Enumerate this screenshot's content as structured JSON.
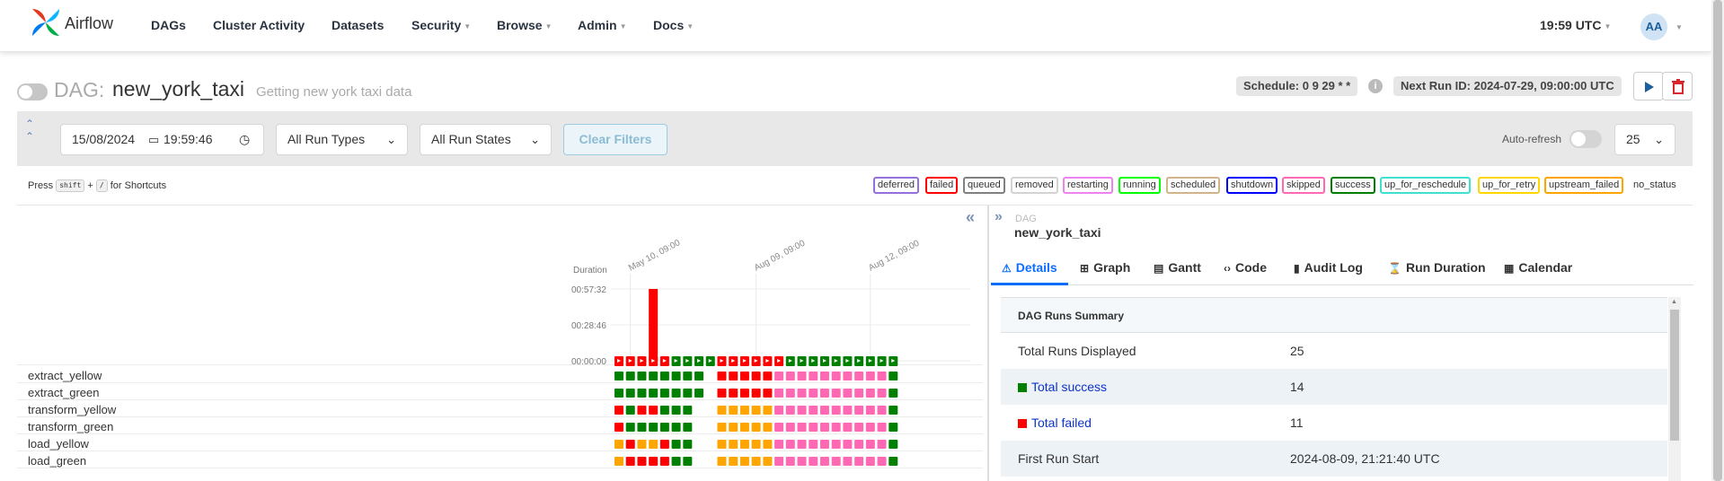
{
  "navbar": {
    "brand": "Airflow",
    "items": [
      {
        "label": "DAGs",
        "dropdown": false
      },
      {
        "label": "Cluster Activity",
        "dropdown": false
      },
      {
        "label": "Datasets",
        "dropdown": false
      },
      {
        "label": "Security",
        "dropdown": true
      },
      {
        "label": "Browse",
        "dropdown": true
      },
      {
        "label": "Admin",
        "dropdown": true
      },
      {
        "label": "Docs",
        "dropdown": true
      }
    ],
    "time": "19:59 UTC",
    "avatar_initials": "AA"
  },
  "dag_header": {
    "prefix": "DAG:",
    "name": "new_york_taxi",
    "description": "Getting new york taxi data",
    "schedule": "Schedule: 0 9 29 * *",
    "next_run": "Next Run ID: 2024-07-29, 09:00:00 UTC"
  },
  "filters": {
    "date": "15/08/2024",
    "time": "19:59:46",
    "run_types": "All Run Types",
    "run_states": "All Run States",
    "clear_label": "Clear Filters",
    "auto_refresh_label": "Auto-refresh",
    "page_size": "25"
  },
  "shortcuts": {
    "press": "Press",
    "key1": "shift",
    "plus": "+",
    "key2": "/",
    "suffix": "for Shortcuts"
  },
  "legend": {
    "items": [
      {
        "label": "deferred",
        "color": "#9370db"
      },
      {
        "label": "failed",
        "color": "#ff0000"
      },
      {
        "label": "queued",
        "color": "#808080"
      },
      {
        "label": "removed",
        "color": "#d3d3d3"
      },
      {
        "label": "restarting",
        "color": "#ee82ee"
      },
      {
        "label": "running",
        "color": "#00ff00"
      },
      {
        "label": "scheduled",
        "color": "#d2b48c"
      },
      {
        "label": "shutdown",
        "color": "#0000ff"
      },
      {
        "label": "skipped",
        "color": "#ff69b4"
      },
      {
        "label": "success",
        "color": "#008000"
      },
      {
        "label": "up_for_reschedule",
        "color": "#40e0d0"
      },
      {
        "label": "up_for_retry",
        "color": "#ffd700"
      },
      {
        "label": "upstream_failed",
        "color": "#ffa500"
      }
    ],
    "no_status": "no_status"
  },
  "grid": {
    "duration_label": "Duration",
    "duration_ticks": [
      "00:57:32",
      "00:28:46",
      "00:00:00"
    ],
    "date_labels": [
      "May 10, 09:00",
      "Aug 09, 09:00",
      "Aug 12, 09:00"
    ],
    "run_states": [
      "failed",
      "failed",
      "failed",
      "failed",
      "failed",
      "success",
      "success",
      "success",
      "success",
      "failed",
      "failed",
      "failed",
      "failed",
      "failed",
      "failed",
      "success",
      "success",
      "success",
      "success",
      "success",
      "success",
      "success",
      "success",
      "success",
      "success"
    ],
    "run_durations_sec": [
      0,
      0,
      0,
      3452,
      0,
      0,
      0,
      0,
      0,
      0,
      0,
      0,
      0,
      0,
      0,
      0,
      0,
      0,
      0,
      0,
      0,
      0,
      0,
      0,
      0
    ],
    "tasks": [
      "extract_yellow",
      "extract_green",
      "transform_yellow",
      "transform_green",
      "load_yellow",
      "load_green"
    ],
    "task_states": [
      [
        "success",
        "success",
        "success",
        "success",
        "success",
        "success",
        "success",
        "success",
        "",
        "failed",
        "failed",
        "failed",
        "failed",
        "failed",
        "skipped",
        "skipped",
        "skipped",
        "skipped",
        "skipped",
        "skipped",
        "skipped",
        "skipped",
        "skipped",
        "skipped",
        "success"
      ],
      [
        "success",
        "success",
        "success",
        "success",
        "success",
        "success",
        "success",
        "success",
        "",
        "failed",
        "failed",
        "failed",
        "failed",
        "failed",
        "skipped",
        "skipped",
        "skipped",
        "skipped",
        "skipped",
        "skipped",
        "skipped",
        "skipped",
        "skipped",
        "skipped",
        "success"
      ],
      [
        "failed",
        "success",
        "failed",
        "failed",
        "success",
        "success",
        "success",
        "",
        "",
        "upstream_failed",
        "upstream_failed",
        "upstream_failed",
        "upstream_failed",
        "upstream_failed",
        "skipped",
        "skipped",
        "skipped",
        "skipped",
        "skipped",
        "skipped",
        "skipped",
        "skipped",
        "skipped",
        "skipped",
        "success"
      ],
      [
        "failed",
        "success",
        "success",
        "success",
        "success",
        "success",
        "success",
        "",
        "",
        "upstream_failed",
        "upstream_failed",
        "upstream_failed",
        "upstream_failed",
        "upstream_failed",
        "skipped",
        "skipped",
        "skipped",
        "skipped",
        "skipped",
        "skipped",
        "skipped",
        "skipped",
        "skipped",
        "skipped",
        "success"
      ],
      [
        "upstream_failed",
        "failed",
        "upstream_failed",
        "upstream_failed",
        "failed",
        "success",
        "success",
        "",
        "",
        "upstream_failed",
        "upstream_failed",
        "upstream_failed",
        "upstream_failed",
        "upstream_failed",
        "skipped",
        "skipped",
        "skipped",
        "skipped",
        "skipped",
        "skipped",
        "skipped",
        "skipped",
        "skipped",
        "skipped",
        "success"
      ],
      [
        "upstream_failed",
        "failed",
        "failed",
        "failed",
        "failed",
        "success",
        "success",
        "",
        "",
        "upstream_failed",
        "upstream_failed",
        "upstream_failed",
        "upstream_failed",
        "upstream_failed",
        "skipped",
        "skipped",
        "skipped",
        "skipped",
        "skipped",
        "skipped",
        "skipped",
        "skipped",
        "skipped",
        "skipped",
        "success"
      ]
    ]
  },
  "details": {
    "label": "DAG",
    "dag_name": "new_york_taxi",
    "tabs": [
      {
        "label": "Details",
        "icon": "warning-icon",
        "glyph": "⚠"
      },
      {
        "label": "Graph",
        "icon": "graph-icon",
        "glyph": "⊞"
      },
      {
        "label": "Gantt",
        "icon": "gantt-icon",
        "glyph": "▤"
      },
      {
        "label": "Code",
        "icon": "code-icon",
        "glyph": "‹›"
      },
      {
        "label": "Audit Log",
        "icon": "document-icon",
        "glyph": "▮"
      },
      {
        "label": "Run Duration",
        "icon": "hourglass-icon",
        "glyph": "⌛"
      },
      {
        "label": "Calendar",
        "icon": "calendar-icon",
        "glyph": "▦"
      }
    ],
    "summary_title": "DAG Runs Summary",
    "rows": [
      {
        "key": "Total Runs Displayed",
        "value": "25"
      },
      {
        "key": "Total success",
        "value": "14"
      },
      {
        "key": "Total failed",
        "value": "11"
      },
      {
        "key": "First Run Start",
        "value": "2024-08-09, 21:21:40 UTC"
      }
    ]
  },
  "colors": {
    "success": "#008000",
    "failed": "#ff0000",
    "upstream_failed": "#ffa500",
    "skipped": "#ff69b4",
    "accent": "#0d6efd"
  }
}
